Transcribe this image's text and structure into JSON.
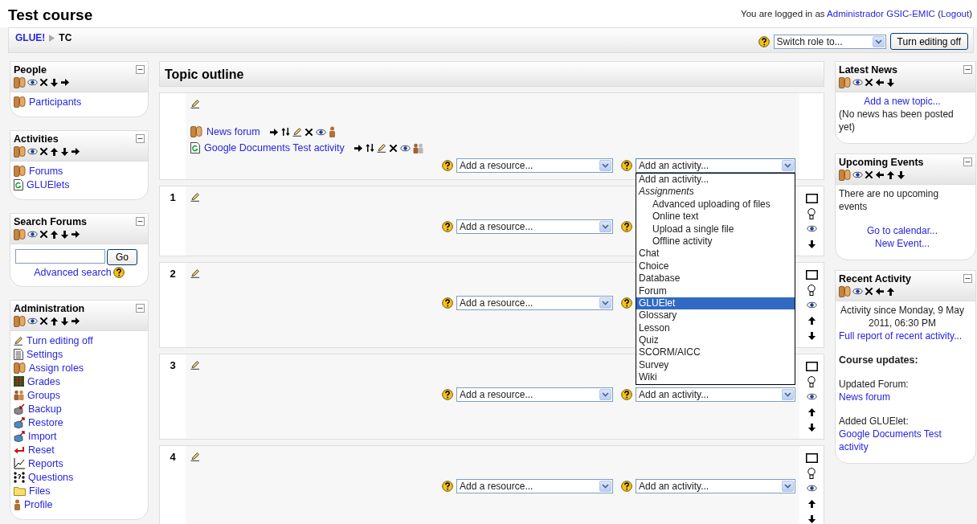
{
  "header": {
    "title": "Test course",
    "login": {
      "before": "You are logged in as",
      "user": "Administrador GSIC-EMIC",
      "open": "(",
      "logout": "Logout",
      "close": ")"
    },
    "breadcrumb": [
      {
        "label": "GLUE!",
        "link": true
      },
      {
        "label": "TC",
        "link": false
      }
    ],
    "role_select": "Switch role to...",
    "editing_button": "Turn editing off"
  },
  "left_blocks": [
    {
      "title": "People",
      "kind": "links",
      "items": [
        "Participants"
      ]
    },
    {
      "title": "Activities",
      "kind": "links",
      "items": [
        "Forums",
        "GLUElets"
      ]
    },
    {
      "title": "Search Forums",
      "kind": "search",
      "button": "Go",
      "link": "Advanced search"
    },
    {
      "title": "Administration",
      "kind": "links",
      "items": [
        "Turn editing off",
        "Settings",
        "Assign roles",
        "Grades",
        "Groups",
        "Backup",
        "Restore",
        "Import",
        "Reset",
        "Reports",
        "Questions",
        "Files",
        "Profile"
      ]
    }
  ],
  "course": {
    "title": "Topic outline",
    "sections": [
      {
        "activities": [
          "News forum",
          "Google Documents Test activity"
        ],
        "resource_select": "Add a resource...",
        "activity_select": "Add an activity...",
        "menu_open": true
      },
      {
        "number": "1",
        "resource_select": "Add a resource...",
        "menu_open": false
      },
      {
        "number": "2",
        "resource_select": "Add a resource...",
        "menu_open": false
      },
      {
        "number": "3",
        "resource_select": "Add a resource...",
        "activity_select": "Add an activity...",
        "menu_open": false
      },
      {
        "number": "4",
        "resource_select": "Add a resource...",
        "activity_select": "Add an activity...",
        "menu_open": false
      }
    ],
    "activity_menu": [
      {
        "label": "Add an activity...",
        "kind": "option",
        "selected": false
      },
      {
        "label": "Assignments",
        "kind": "group",
        "selected": false
      },
      {
        "label": "Advanced uploading of files",
        "kind": "suboption",
        "selected": false
      },
      {
        "label": "Online text",
        "kind": "suboption",
        "selected": false
      },
      {
        "label": "Upload a single file",
        "kind": "suboption",
        "selected": false
      },
      {
        "label": "Offline activity",
        "kind": "suboption",
        "selected": false
      },
      {
        "label": "Chat",
        "kind": "option",
        "selected": false
      },
      {
        "label": "Choice",
        "kind": "option",
        "selected": false
      },
      {
        "label": "Database",
        "kind": "option",
        "selected": false
      },
      {
        "label": "Forum",
        "kind": "option",
        "selected": false
      },
      {
        "label": "GLUElet",
        "kind": "option",
        "selected": true
      },
      {
        "label": "Glossary",
        "kind": "option",
        "selected": false
      },
      {
        "label": "Lesson",
        "kind": "option",
        "selected": false
      },
      {
        "label": "Quiz",
        "kind": "option",
        "selected": false
      },
      {
        "label": "SCORM/AICC",
        "kind": "option",
        "selected": false
      },
      {
        "label": "Survey",
        "kind": "option",
        "selected": false
      },
      {
        "label": "Wiki",
        "kind": "option",
        "selected": false
      }
    ]
  },
  "right_blocks": [
    {
      "title": "Latest News",
      "kind": "paragraphs",
      "paragraphs": [
        {
          "lines": [
            {
              "kind": "centered_link",
              "text": "Add a new topic..."
            },
            {
              "kind": "text",
              "text": "(No news has been posted yet)"
            }
          ]
        }
      ]
    },
    {
      "title": "Upcoming Events",
      "kind": "paragraphs",
      "paragraphs": [
        {
          "lines": [
            {
              "kind": "text",
              "text": "There are no upcoming events"
            }
          ]
        },
        {
          "lines": [
            {
              "kind": "centered_link",
              "text": "Go to calendar..."
            },
            {
              "kind": "centered_link",
              "text": "New Event..."
            }
          ]
        }
      ]
    },
    {
      "title": "Recent Activity",
      "kind": "paragraphs",
      "paragraphs": [
        {
          "lines": [
            {
              "kind": "centered_text",
              "text": "Activity since Monday, 9 May 2011, 06:30 PM"
            },
            {
              "kind": "link",
              "text": "Full report of recent activity..."
            }
          ]
        },
        {
          "lines": [
            {
              "kind": "heading",
              "text": "Course updates:"
            }
          ]
        },
        {
          "lines": [
            {
              "kind": "text",
              "text": "Updated Forum:"
            },
            {
              "kind": "link",
              "text": "News forum"
            }
          ]
        },
        {
          "lines": [
            {
              "kind": "text",
              "text": "Added GLUElet:"
            },
            {
              "kind": "link",
              "text": "Google Documents Test activity"
            }
          ]
        }
      ]
    }
  ]
}
